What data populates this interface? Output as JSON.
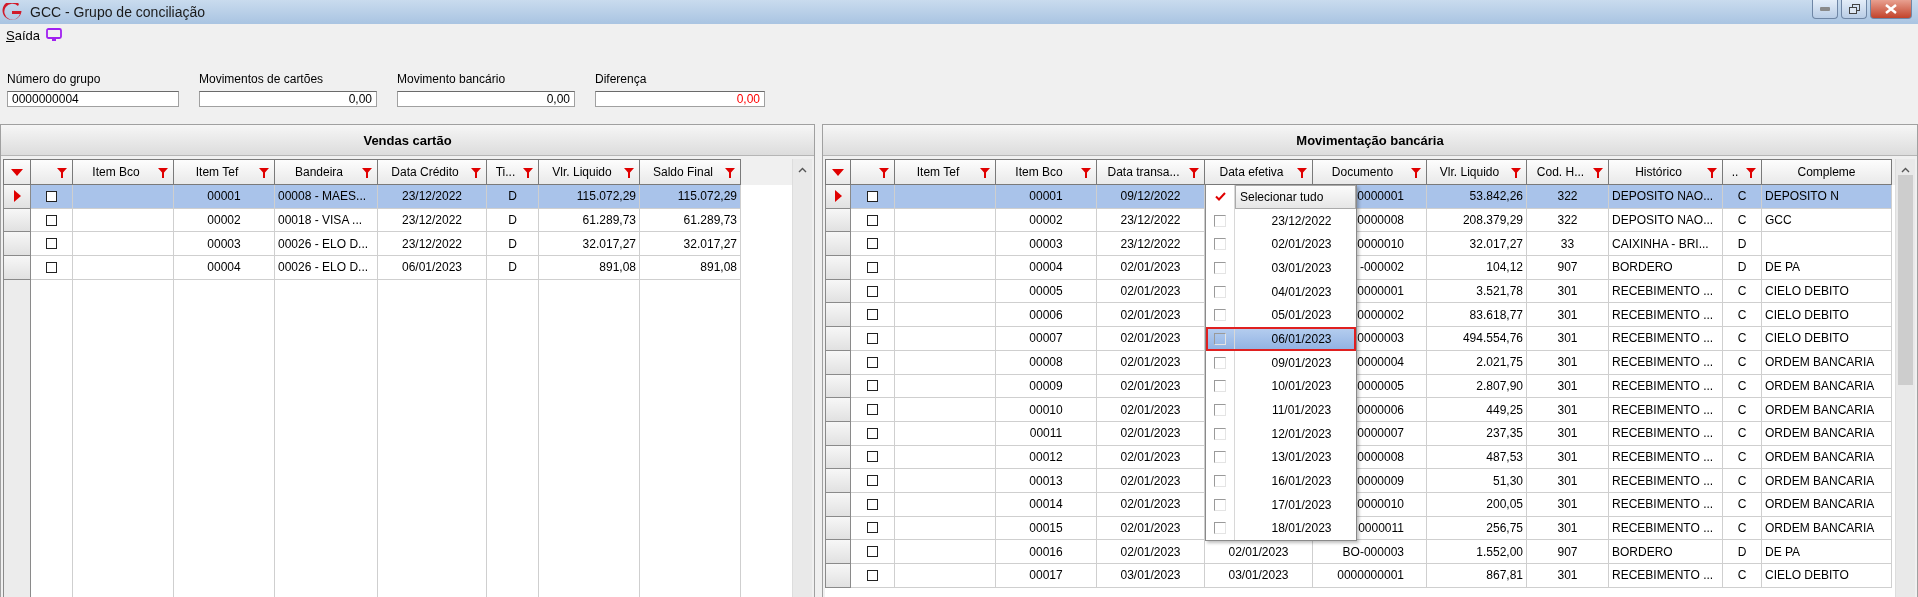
{
  "window": {
    "title": "GCC - Grupo de conciliação"
  },
  "menu": [
    {
      "label": "Saída"
    }
  ],
  "fields": [
    {
      "label": "Número do grupo",
      "value": "0000000004",
      "kind": "text"
    },
    {
      "label": "Movimentos de cartões",
      "value": "0,00",
      "kind": "amount",
      "negative": false
    },
    {
      "label": "Movimento bancário",
      "value": "0,00",
      "kind": "amount",
      "negative": false
    },
    {
      "label": "Diferença",
      "value": "0,00",
      "kind": "amount",
      "negative": true
    }
  ],
  "vendas": {
    "title": "Vendas cartão",
    "columns": [
      {
        "label": "Item Bco",
        "filter": true
      },
      {
        "label": "Item Tef",
        "filter": true
      },
      {
        "label": "Bandeira",
        "filter": true
      },
      {
        "label": "Data Crédito",
        "filter": true
      },
      {
        "label": "Ti...",
        "filter": true
      },
      {
        "label": "Vlr. Liquido",
        "filter": true
      },
      {
        "label": "Saldo Final",
        "filter": true
      }
    ],
    "rows": [
      {
        "selected": true,
        "checked": false,
        "item_tef": "00001",
        "bandeira": "00008 - MAES...",
        "data_credito": "23/12/2022",
        "tipo": "D",
        "vlr_liquido": "115.072,29",
        "saldo_final": "115.072,29"
      },
      {
        "selected": false,
        "checked": false,
        "item_tef": "00002",
        "bandeira": "00018 - VISA ...",
        "data_credito": "23/12/2022",
        "tipo": "D",
        "vlr_liquido": "61.289,73",
        "saldo_final": "61.289,73"
      },
      {
        "selected": false,
        "checked": false,
        "item_tef": "00003",
        "bandeira": "00026 - ELO D...",
        "data_credito": "23/12/2022",
        "tipo": "D",
        "vlr_liquido": "32.017,27",
        "saldo_final": "32.017,27"
      },
      {
        "selected": false,
        "checked": false,
        "item_tef": "00004",
        "bandeira": "00026 - ELO D...",
        "data_credito": "06/01/2023",
        "tipo": "D",
        "vlr_liquido": "891,08",
        "saldo_final": "891,08"
      }
    ]
  },
  "movimentacao": {
    "title": "Movimentação bancária",
    "columns": [
      {
        "label": "Item Tef",
        "filter": true
      },
      {
        "label": "Item Bco",
        "filter": true
      },
      {
        "label": "Data transa...",
        "filter": true
      },
      {
        "label": "Data efetiva",
        "filter": true
      },
      {
        "label": "Documento",
        "filter": true
      },
      {
        "label": "Vlr. Liquido",
        "filter": true
      },
      {
        "label": "Cod. H...",
        "filter": true
      },
      {
        "label": "Histórico",
        "filter": true
      },
      {
        "label": "..",
        "filter": true
      },
      {
        "label": "Compleme",
        "filter": false
      }
    ],
    "rows": [
      {
        "selected": true,
        "checked": false,
        "item_bco": "00001",
        "data_transacao": "09/12/2022",
        "documento": "0000001",
        "vlr_liquido": "53.842,26",
        "cod_historico": "322",
        "historico": "DEPOSITO NAO...",
        "d_c": "C",
        "complemento": "DEPOSITO N"
      },
      {
        "selected": false,
        "checked": false,
        "item_bco": "00002",
        "data_transacao": "23/12/2022",
        "documento": "0000008",
        "vlr_liquido": "208.379,29",
        "cod_historico": "322",
        "historico": "DEPOSITO NAO...",
        "d_c": "C",
        "complemento": "GCC"
      },
      {
        "selected": false,
        "checked": false,
        "item_bco": "00003",
        "data_transacao": "23/12/2022",
        "documento": "0000010",
        "vlr_liquido": "32.017,27",
        "cod_historico": "33",
        "historico": "CAIXINHA - BRI...",
        "d_c": "D"
      },
      {
        "selected": false,
        "checked": false,
        "item_bco": "00004",
        "data_transacao": "02/01/2023",
        "documento": "-000002",
        "vlr_liquido": "104,12",
        "cod_historico": "907",
        "historico": "BORDERO",
        "d_c": "D",
        "complemento": "DE PA"
      },
      {
        "selected": false,
        "checked": false,
        "item_bco": "00005",
        "data_transacao": "02/01/2023",
        "documento": "0000001",
        "vlr_liquido": "3.521,78",
        "cod_historico": "301",
        "historico": "RECEBIMENTO ...",
        "d_c": "C",
        "complemento": "CIELO DEBITO"
      },
      {
        "selected": false,
        "checked": false,
        "item_bco": "00006",
        "data_transacao": "02/01/2023",
        "documento": "0000002",
        "vlr_liquido": "83.618,77",
        "cod_historico": "301",
        "historico": "RECEBIMENTO ...",
        "d_c": "C",
        "complemento": "CIELO DEBITO"
      },
      {
        "selected": false,
        "checked": false,
        "item_bco": "00007",
        "data_transacao": "02/01/2023",
        "documento": "0000003",
        "vlr_liquido": "494.554,76",
        "cod_historico": "301",
        "historico": "RECEBIMENTO ...",
        "d_c": "C",
        "complemento": "CIELO DEBITO"
      },
      {
        "selected": false,
        "checked": false,
        "item_bco": "00008",
        "data_transacao": "02/01/2023",
        "documento": "0000004",
        "vlr_liquido": "2.021,75",
        "cod_historico": "301",
        "historico": "RECEBIMENTO ...",
        "d_c": "C",
        "complemento": "ORDEM BANCARIA"
      },
      {
        "selected": false,
        "checked": false,
        "item_bco": "00009",
        "data_transacao": "02/01/2023",
        "documento": "0000005",
        "vlr_liquido": "2.807,90",
        "cod_historico": "301",
        "historico": "RECEBIMENTO ...",
        "d_c": "C",
        "complemento": "ORDEM BANCARIA"
      },
      {
        "selected": false,
        "checked": false,
        "item_bco": "00010",
        "data_transacao": "02/01/2023",
        "documento": "0000006",
        "vlr_liquido": "449,25",
        "cod_historico": "301",
        "historico": "RECEBIMENTO ...",
        "d_c": "C",
        "complemento": "ORDEM BANCARIA"
      },
      {
        "selected": false,
        "checked": false,
        "item_bco": "00011",
        "data_transacao": "02/01/2023",
        "documento": "0000007",
        "vlr_liquido": "237,35",
        "cod_historico": "301",
        "historico": "RECEBIMENTO ...",
        "d_c": "C",
        "complemento": "ORDEM BANCARIA"
      },
      {
        "selected": false,
        "checked": false,
        "item_bco": "00012",
        "data_transacao": "02/01/2023",
        "documento": "0000008",
        "vlr_liquido": "487,53",
        "cod_historico": "301",
        "historico": "RECEBIMENTO ...",
        "d_c": "C",
        "complemento": "ORDEM BANCARIA"
      },
      {
        "selected": false,
        "checked": false,
        "item_bco": "00013",
        "data_transacao": "02/01/2023",
        "documento": "0000009",
        "vlr_liquido": "51,30",
        "cod_historico": "301",
        "historico": "RECEBIMENTO ...",
        "d_c": "C",
        "complemento": "ORDEM BANCARIA"
      },
      {
        "selected": false,
        "checked": false,
        "item_bco": "00014",
        "data_transacao": "02/01/2023",
        "documento": "0000010",
        "vlr_liquido": "200,05",
        "cod_historico": "301",
        "historico": "RECEBIMENTO ...",
        "d_c": "C",
        "complemento": "ORDEM BANCARIA"
      },
      {
        "selected": false,
        "checked": false,
        "item_bco": "00015",
        "data_transacao": "02/01/2023",
        "documento": "0000011",
        "vlr_liquido": "256,75",
        "cod_historico": "301",
        "historico": "RECEBIMENTO ...",
        "d_c": "C",
        "complemento": "ORDEM BANCARIA"
      },
      {
        "selected": false,
        "checked": false,
        "item_bco": "00016",
        "data_transacao": "02/01/2023",
        "data_efetiva": "02/01/2023",
        "documento": "BO-000003",
        "vlr_liquido": "1.552,00",
        "cod_historico": "907",
        "historico": "BORDERO",
        "d_c": "D",
        "complemento": "DE PA"
      },
      {
        "selected": false,
        "checked": false,
        "item_bco": "00017",
        "data_transacao": "03/01/2023",
        "data_efetiva": "03/01/2023",
        "documento": "0000000001",
        "vlr_liquido": "867,81",
        "cod_historico": "301",
        "historico": "RECEBIMENTO ...",
        "d_c": "C",
        "complemento": "CIELO DEBITO"
      }
    ],
    "filter_dropdown": {
      "select_all": {
        "label": "Selecionar tudo",
        "checked": true
      },
      "options": [
        {
          "label": "23/12/2022",
          "checked": false,
          "selected": false
        },
        {
          "label": "02/01/2023",
          "checked": false,
          "selected": false
        },
        {
          "label": "03/01/2023",
          "checked": false,
          "selected": false
        },
        {
          "label": "04/01/2023",
          "checked": false,
          "selected": false
        },
        {
          "label": "05/01/2023",
          "checked": false,
          "selected": false
        },
        {
          "label": "06/01/2023",
          "checked": false,
          "selected": true
        },
        {
          "label": "09/01/2023",
          "checked": false,
          "selected": false
        },
        {
          "label": "10/01/2023",
          "checked": false,
          "selected": false
        },
        {
          "label": "11/01/2023",
          "checked": false,
          "selected": false
        },
        {
          "label": "12/01/2023",
          "checked": false,
          "selected": false
        },
        {
          "label": "13/01/2023",
          "checked": false,
          "selected": false
        },
        {
          "label": "16/01/2023",
          "checked": false,
          "selected": false
        },
        {
          "label": "17/01/2023",
          "checked": false,
          "selected": false
        },
        {
          "label": "18/01/2023",
          "checked": false,
          "selected": false
        }
      ]
    }
  }
}
